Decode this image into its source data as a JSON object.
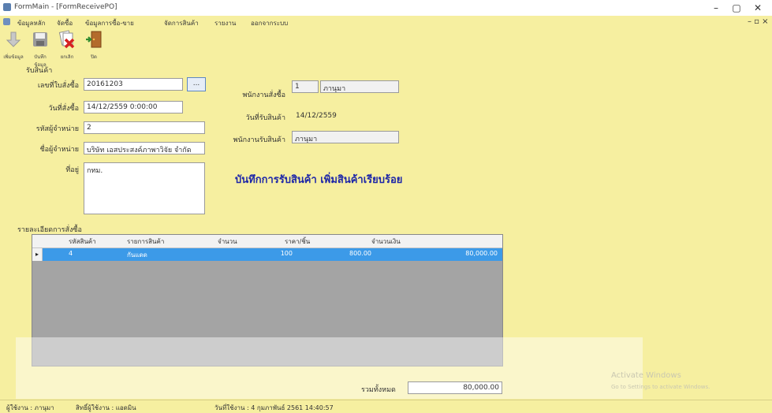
{
  "window": {
    "title": "FormMain - [FormReceivePO]",
    "minimize": "–",
    "maximize": "▢",
    "close": "✕"
  },
  "menu": {
    "items": [
      "ข้อมูลหลัก",
      "จัดซื้อ",
      "ข้อมูลการซื้อ-ขาย",
      "จัดการสินค้า",
      "รายงาน",
      "ออกจากระบบ"
    ],
    "mdi_controls": "– ▫ ×"
  },
  "toolbar": {
    "buttons": [
      {
        "label": "เพิ่มข้อมูล",
        "icon": "add-icon"
      },
      {
        "label": "บันทึกข้อมูล",
        "icon": "save-icon"
      },
      {
        "label": "ยกเลิก",
        "icon": "cancel-icon"
      },
      {
        "label": "ปิด",
        "icon": "exit-door-icon"
      }
    ]
  },
  "form": {
    "section_receive": "รับสินค้า",
    "po_no_label": "เลขที่ใบสั่งซื้อ",
    "po_no": "20161203",
    "browse": "...",
    "order_date_label": "วันที่สั่งซื้อ",
    "order_date": "14/12/2559 0:00:00",
    "supplier_id_label": "รหัสผู้จำหน่าย",
    "supplier_id": "2",
    "supplier_name_label": "ชื่อผู้จำหน่าย",
    "supplier_name": "บริษัท เอสประสงค์ภาพาวิจัย จำกัด",
    "address_label": "ที่อยู่",
    "address": "กทม.",
    "order_staff_label": "พนักงานสั่งซื้อ",
    "order_staff_id": "1",
    "order_staff_name": "ภานุมา",
    "receive_date_label": "วันที่รับสินค้า",
    "receive_date": "14/12/2559",
    "receive_staff_label": "พนักงานรับสินค้า",
    "receive_staff": "ภานุมา",
    "status_message": "บันทึกการรับสินค้า เพิ่มสินค้าเรียบร้อย"
  },
  "details": {
    "section_label": "รายละเอียดการสั่งซื้อ",
    "columns": [
      "รหัสสินค้า",
      "รายการสินค้า",
      "จำนวน",
      "ราคา/ชิ้น",
      "จำนวนเงิน"
    ],
    "rows": [
      {
        "indicator": "▸",
        "code": "4",
        "name": "กันแดด",
        "qty": "100",
        "price": "800.00",
        "amount": "80,000.00"
      }
    ]
  },
  "total": {
    "label": "รวมทั้งหมด",
    "value": "80,000.00"
  },
  "watermark": {
    "line1": "Activate Windows",
    "line2": "Go to Settings to activate Windows."
  },
  "statusbar": {
    "user": "ผู้ใช้งาน : ภานุมา",
    "role": "สิทธิ์ผู้ใช้งาน : แอดมิน",
    "datetime": "วันที่ใช้งาน : 4 กุมภาพันธ์ 2561 14:40:57"
  },
  "colors": {
    "background": "#f6efa0",
    "selection": "#3c9ae8",
    "status_message": "#1e27a8"
  }
}
